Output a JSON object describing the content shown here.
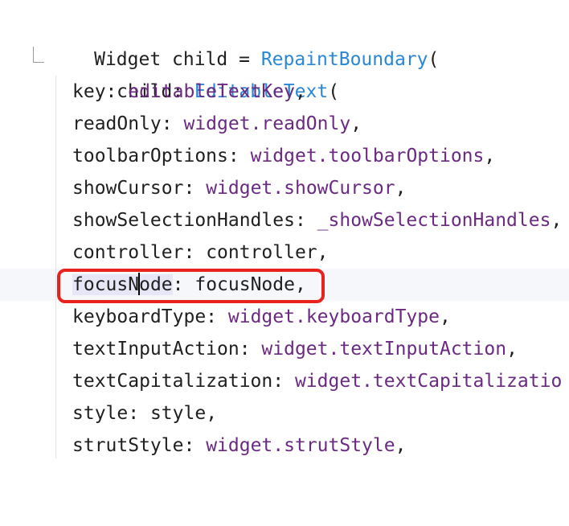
{
  "code": {
    "line1": {
      "decl": "Widget child = ",
      "cls": "RepaintBoundary",
      "open": "("
    },
    "line2": {
      "key": "child: ",
      "cls": "EditableText",
      "open": "("
    },
    "params": [
      {
        "name": "key",
        "sep": ": ",
        "value_obj": "",
        "value_prop": "editableTextKey",
        "end": ","
      },
      {
        "name": "readOnly",
        "sep": ": ",
        "value_obj": "widget.",
        "value_prop": "readOnly",
        "end": ","
      },
      {
        "name": "toolbarOptions",
        "sep": ": ",
        "value_obj": "widget.",
        "value_prop": "toolbarOptions",
        "end": ","
      },
      {
        "name": "showCursor",
        "sep": ": ",
        "value_obj": "widget.",
        "value_prop": "showCursor",
        "end": ","
      },
      {
        "name": "showSelectionHandles",
        "sep": ": ",
        "value_obj": "",
        "value_prop": "_showSelectionHandles",
        "end": ","
      },
      {
        "name": "controller",
        "sep": ": ",
        "value_plain": "controller",
        "end": ","
      },
      {
        "name_a": "focusN",
        "name_b": "ode",
        "sep": ": ",
        "value_plain": "focusNode",
        "end": ","
      },
      {
        "name": "keyboardType",
        "sep": ": ",
        "value_obj": "widget.",
        "value_prop": "keyboardType",
        "end": ","
      },
      {
        "name": "textInputAction",
        "sep": ": ",
        "value_obj": "widget.",
        "value_prop": "textInputAction",
        "end": ","
      },
      {
        "name": "textCapitalization",
        "sep": ": ",
        "value_obj": "widget.",
        "value_prop": "textCapitalizatio",
        "end": ""
      },
      {
        "name": "style",
        "sep": ": ",
        "value_plain": "style",
        "end": ","
      },
      {
        "name": "strutStyle",
        "sep": ": ",
        "value_obj": "widget.",
        "value_prop": "strutStyle",
        "end": ","
      }
    ]
  },
  "colors": {
    "class_name": "#2a87d8",
    "property": "#6b2a82",
    "highlight_border": "#e8231e"
  }
}
